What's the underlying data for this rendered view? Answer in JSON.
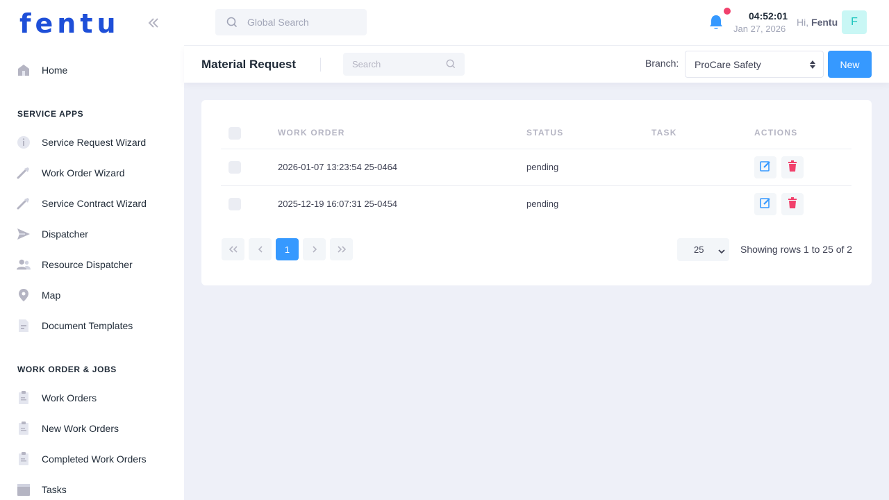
{
  "brand": {
    "logo": "fentu"
  },
  "sidebar": {
    "home": "Home",
    "section1": "SERVICE APPS",
    "apps": [
      {
        "label": "Service Request Wizard",
        "icon": "info-icon"
      },
      {
        "label": "Work Order Wizard",
        "icon": "wrench-icon"
      },
      {
        "label": "Service Contract Wizard",
        "icon": "wrench-icon"
      },
      {
        "label": "Dispatcher",
        "icon": "send-icon"
      },
      {
        "label": "Resource Dispatcher",
        "icon": "users-icon"
      },
      {
        "label": "Map",
        "icon": "map-pin-icon"
      },
      {
        "label": "Document Templates",
        "icon": "document-icon"
      }
    ],
    "section2": "WORK ORDER & JOBS",
    "jobs": [
      {
        "label": "Work Orders",
        "icon": "clipboard-icon"
      },
      {
        "label": "New Work Orders",
        "icon": "clipboard-icon"
      },
      {
        "label": "Completed Work Orders",
        "icon": "clipboard-icon"
      },
      {
        "label": "Tasks",
        "icon": "tasks-icon"
      }
    ]
  },
  "header": {
    "search_placeholder": "Global Search",
    "time": "04:52:01",
    "date": "Jan 27, 2026",
    "greeting": "Hi,",
    "user_name": "Fentu",
    "avatar_letter": "F"
  },
  "subheader": {
    "title": "Material Request",
    "search_placeholder": "Search",
    "branch_label": "Branch:",
    "branch_value": "ProCare Safety",
    "new_label": "New"
  },
  "table": {
    "columns": [
      "WORK ORDER",
      "STATUS",
      "TASK",
      "ACTIONS"
    ],
    "rows": [
      {
        "work_order": "2026-01-07 13:23:54 25-0464",
        "status": "pending",
        "task": ""
      },
      {
        "work_order": "2025-12-19 16:07:31 25-0454",
        "status": "pending",
        "task": ""
      }
    ]
  },
  "pagination": {
    "current_page": "1",
    "per_page": "25",
    "info": "Showing rows 1 to 25 of 2"
  },
  "colors": {
    "primary": "#3699ff",
    "brand": "#1e4fd8",
    "danger": "#f1416c",
    "avatar_bg": "#c9f7f5"
  }
}
